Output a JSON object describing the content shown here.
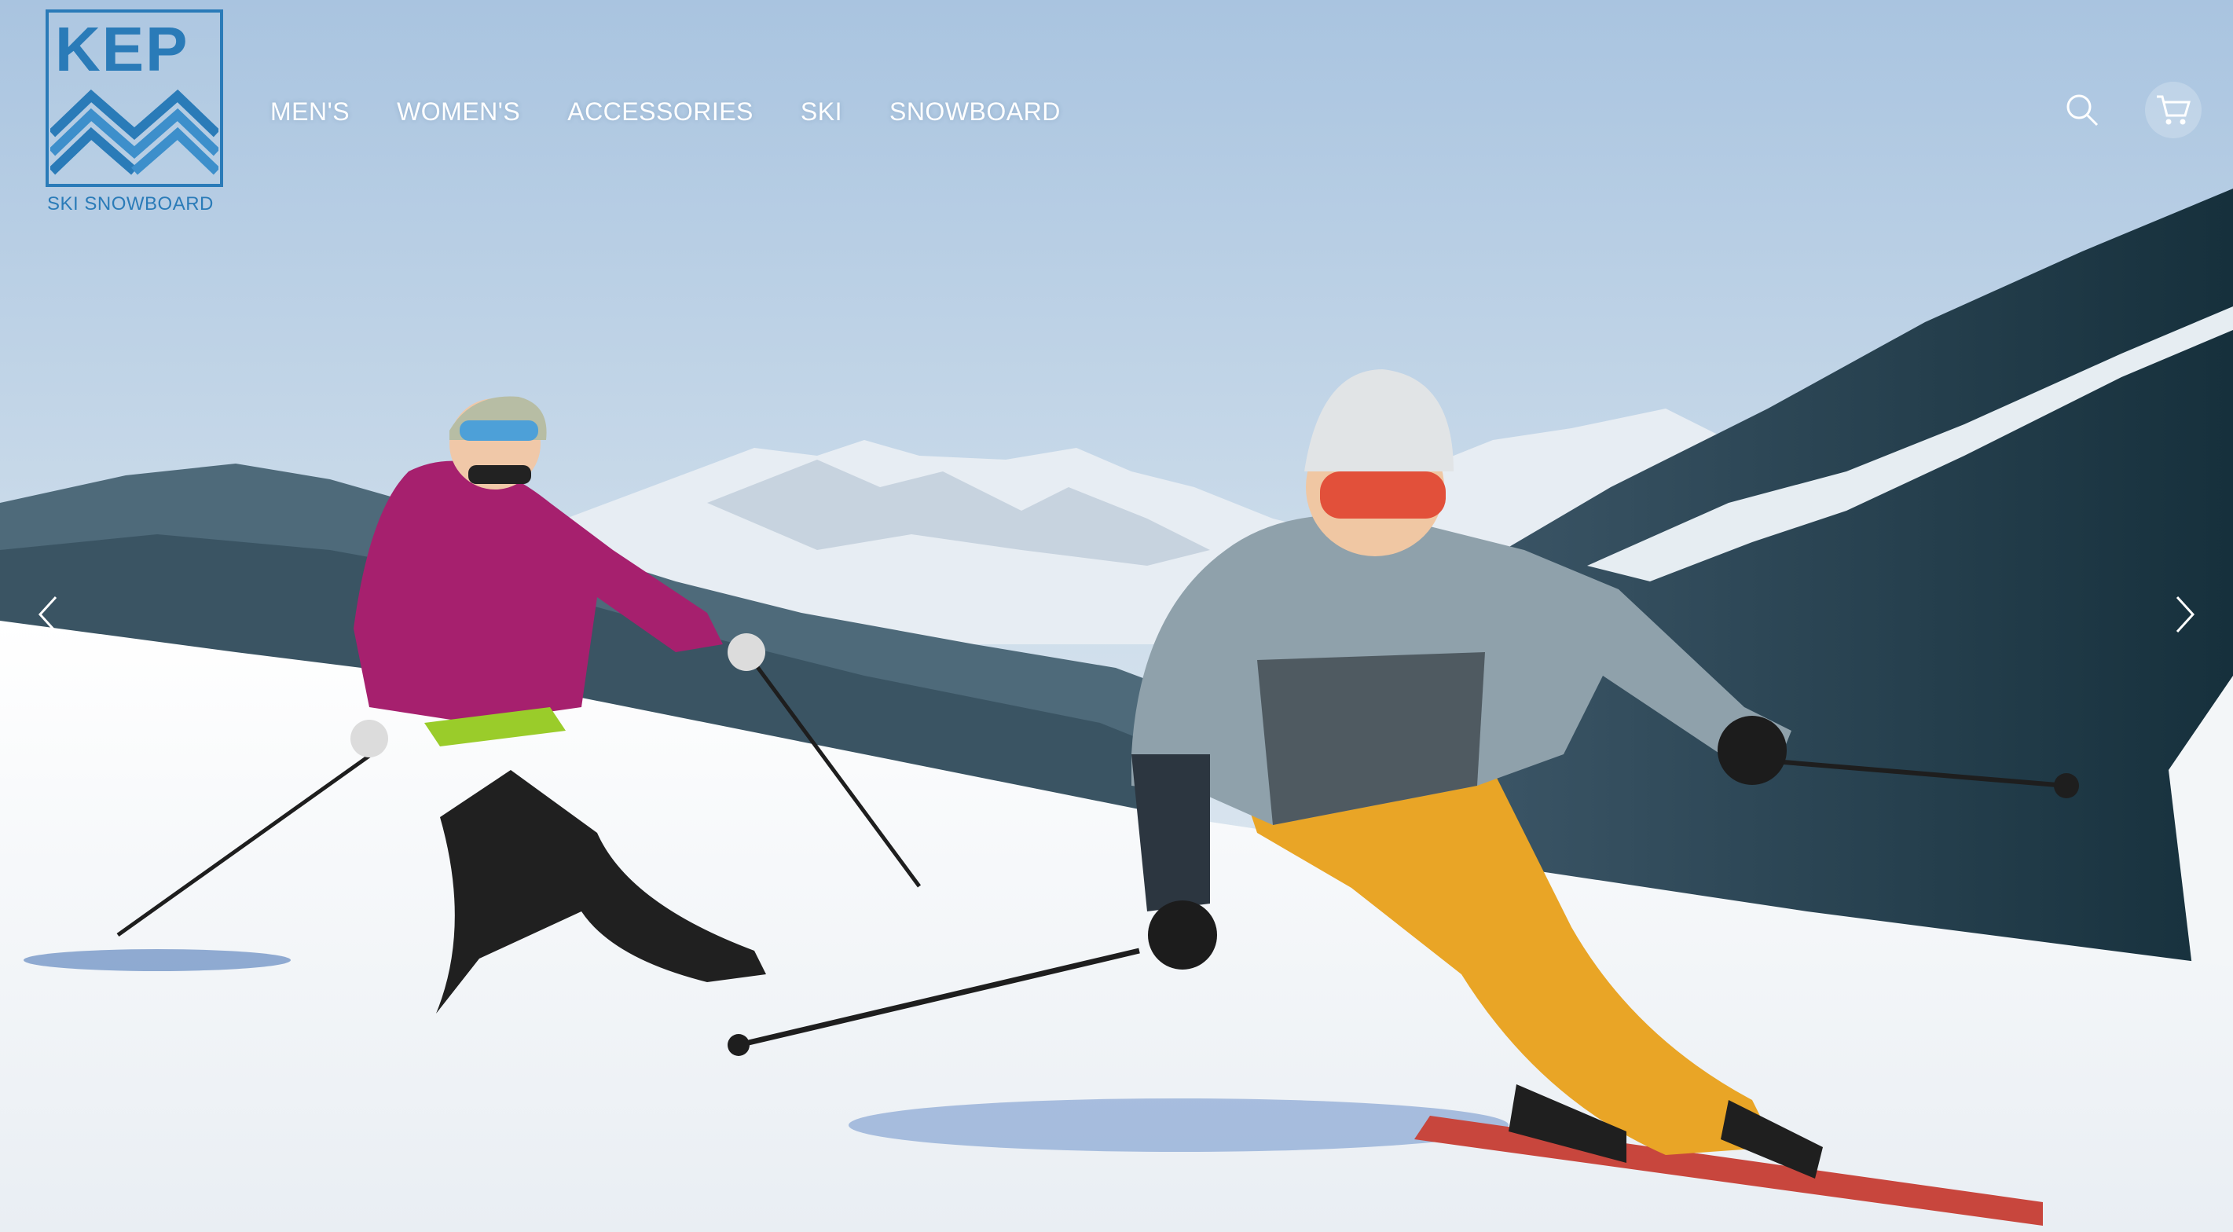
{
  "brand": {
    "name": "KEP",
    "tagline": "SKI SNOWBOARD",
    "color": "#2a7bb8"
  },
  "nav": {
    "items": [
      {
        "label": "MEN'S"
      },
      {
        "label": "WOMEN'S"
      },
      {
        "label": "ACCESSORIES"
      },
      {
        "label": "SKI"
      },
      {
        "label": "SNOWBOARD"
      }
    ]
  },
  "header_icons": [
    "search-icon",
    "cart-icon"
  ],
  "carousel": {
    "prev_icon": "chevron-left-icon",
    "next_icon": "chevron-right-icon",
    "slide_description_visual": "hero-ski-photo"
  },
  "colors": {
    "sky_top": "#aac6e3",
    "sky_bottom": "#e4edf4",
    "snow": "#f4f6f8",
    "forest": "#1d3a45",
    "nav_text": "#ffffff"
  }
}
